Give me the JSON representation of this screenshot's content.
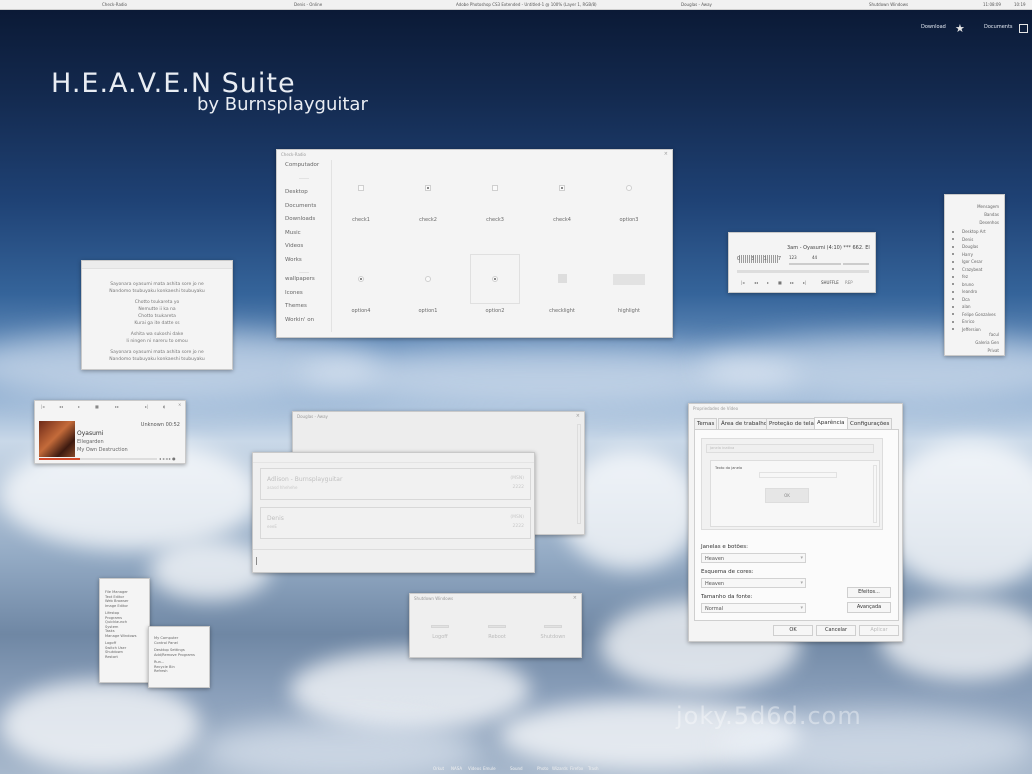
{
  "top_bar": {
    "items": [
      "Check-Radio",
      "Denis - Online",
      "Adobe Photoshop CS3 Extended - Untitled-1 @ 100% (Layer 1, RGB/8)",
      "Douglas - Away",
      "Shutdown Windows"
    ],
    "clock": "11:08:09",
    "time": "10:19"
  },
  "top_right": {
    "download_label": "Download",
    "documents_label": "Documents"
  },
  "title": {
    "main": "H.E.A.V.E.N  Suite",
    "sub": "by Burnsplayguitar"
  },
  "check_radio": {
    "title": "Check-Radio",
    "sidebar": [
      "Computador",
      "-----",
      "Desktop",
      "Documents",
      "Downloads",
      "Music",
      "Videos",
      "Works",
      "-----",
      "wallpapers",
      "Icones",
      "Themes",
      "Workin' on"
    ],
    "row1": [
      "check1",
      "check2",
      "check3",
      "check4",
      "option3"
    ],
    "row2": [
      "option4",
      "option1",
      "option2",
      "checklight",
      "highlight"
    ]
  },
  "lyrics": {
    "lines": [
      "Sayonara oyasumi mata ashita sore jo ne",
      "Nandomo tsubuyaku konkaeshi tsubuyaku",
      "",
      "Chotto tsukareta yo",
      "Nemutte ii ka na",
      "Chotto tsukareta",
      "Kurai ga ite datte ss",
      "",
      "Ashita wa sukoshi dake",
      "Ii ningen ni nareru to omou",
      "",
      "Sayonara oyasumi mata ashita sore jo ne",
      "Nandomo tsubuyaku konkaeshi tsubuyaku"
    ]
  },
  "player": {
    "meta": "Unknown  00:52",
    "track": "Oyasumi",
    "artist": "Ellegarden",
    "album": "My Own Destruction",
    "progress": 0.35
  },
  "music_mini": {
    "track": "3am - Oyasumi (4:10)  ***  662. El",
    "kbps": "123",
    "khz": "44",
    "controls": [
      "|◂",
      "◂◂",
      "▸",
      "■",
      "▸▸",
      "▸|"
    ],
    "shuffle": "SHUFFLE",
    "rep": "REP",
    "eq_labels": [
      "0",
      "3",
      "1",
      "7"
    ]
  },
  "list_panel": {
    "header": [
      "Mensagem",
      "Bandas",
      "Desenhos"
    ],
    "items": [
      "Desktop Art",
      "Denis",
      "Douglas",
      "Harry",
      "Igor Cesar",
      "Crazybeat",
      "fez",
      "bruno",
      "leandro",
      "Dca",
      "alan",
      "Felipe Gonzalves",
      "Enrico",
      "Jeffersion"
    ],
    "footer": [
      "facul",
      "Galeria Gen",
      "Privat"
    ]
  },
  "pidgin_back": {
    "title": "Douglas - Away"
  },
  "pidgin": {
    "buddies": [
      {
        "name": "Adlison - Burnsplayguitar",
        "status": "asasd hhehehe",
        "r1": "(MSN)",
        "r2": "2222"
      },
      {
        "name": "Denis",
        "status": "eeeE",
        "r1": "(MSN)",
        "r2": "2222"
      }
    ],
    "input": "|"
  },
  "shutdown": {
    "title": "Shutdown Windows",
    "buttons": [
      "Logoff",
      "Reboot",
      "Shutdown"
    ]
  },
  "video_props": {
    "title": "Propriedades de Vídeo",
    "tabs": [
      "Temas",
      "Área de trabalho",
      "Proteção de tela",
      "Aparência",
      "Configurações"
    ],
    "preview_inactive": "Janela inativa",
    "preview_active": "Texto da janela",
    "preview_ok": "OK",
    "label_windows": "Janelas e botões:",
    "val_windows": "Heaven",
    "label_colors": "Esquema de cores:",
    "val_colors": "Heaven",
    "label_font": "Tamanho da fonte:",
    "val_font": "Normal",
    "btn_effects": "Efeitos...",
    "btn_advanced": "Avançada",
    "btn_ok": "OK",
    "btn_cancel": "Cancelar",
    "btn_apply": "Aplicar"
  },
  "start_menu_1": {
    "group1": [
      "File Manager",
      "Text Editor",
      "Web Browser",
      "Image Editor"
    ],
    "group2": [
      "Lifestop",
      "Programs",
      "Quicklaunch",
      "System",
      "Tasks",
      "Manage Windows"
    ],
    "group3": [
      "Logoff",
      "Switch User",
      "Shutdown",
      "Restart"
    ]
  },
  "start_menu_2": {
    "group1": [
      "My Computer",
      "Control Panel"
    ],
    "group2": [
      "Desktop Settings",
      "Add/Remove Programs"
    ],
    "group3": [
      "Run...",
      "Recycle Bin",
      "Refresh"
    ]
  },
  "dock": [
    "Orkut",
    "NASA",
    "Videos",
    "Emule",
    "Sound",
    "Photo",
    "Wizards",
    "Firefox",
    "Trash"
  ],
  "watermark": "joky.5d6d.com"
}
